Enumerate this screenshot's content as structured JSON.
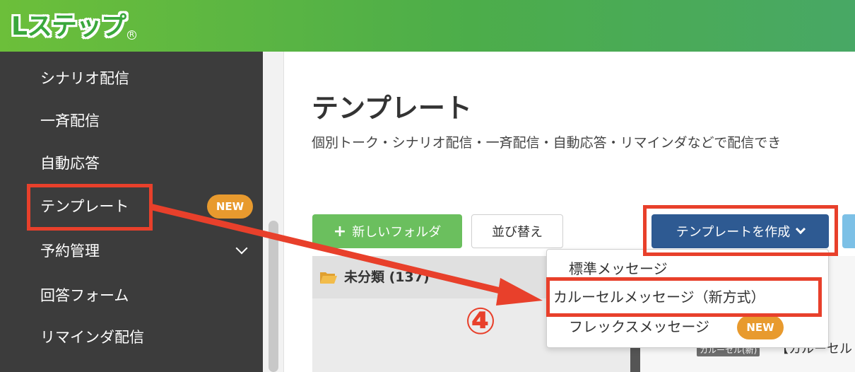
{
  "header": {
    "logo_text": "Lステップ",
    "logo_reg": "R"
  },
  "sidebar": {
    "items": [
      {
        "label": "シナリオ配信"
      },
      {
        "label": "一斉配信"
      },
      {
        "label": "自動応答"
      },
      {
        "label": "テンプレート",
        "badge": "NEW"
      },
      {
        "label": "予約管理"
      },
      {
        "label": "回答フォーム"
      },
      {
        "label": "リマインダ配信"
      }
    ]
  },
  "main": {
    "title": "テンプレート",
    "subtitle": "個別トーク・シナリオ配信・一斉配信・自動応答・リマインダなどで配信でき",
    "new_folder_label": "新しいフォルダ",
    "sort_label": "並び替え",
    "create_label": "テンプレートを作成",
    "folder_label": "未分類 (137)",
    "carousel_tag": "カルーセル(新)",
    "carousel_text": "【カルーセル"
  },
  "dropdown": {
    "items": [
      {
        "label": "標準メッセージ"
      },
      {
        "label": "カルーセルメッセージ（新方式）"
      },
      {
        "label": "フレックスメッセージ",
        "badge": "NEW"
      }
    ]
  },
  "annotation": {
    "step": "④",
    "color": "#e8402b"
  },
  "colors": {
    "header_green": "#4cad4a",
    "sidebar_bg": "#3c3c3c",
    "badge_orange": "#e89a2e",
    "create_blue": "#2e5a92",
    "folder_green": "#6bbf5e"
  }
}
